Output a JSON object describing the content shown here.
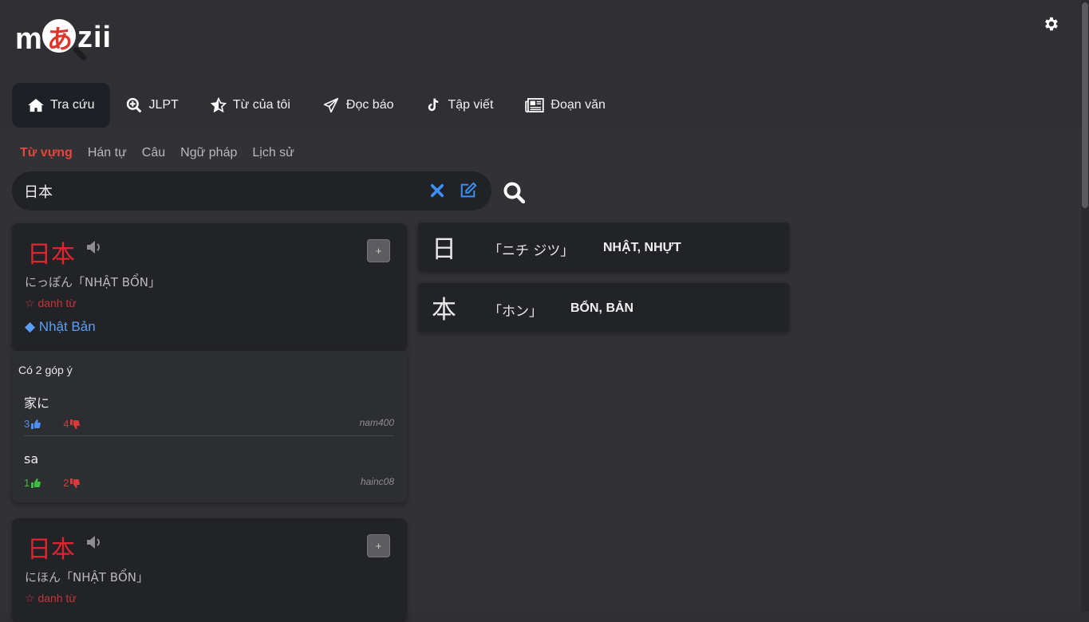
{
  "logo": {
    "left": "m",
    "kana": "あ",
    "right": "zii"
  },
  "nav": [
    {
      "label": "Tra cứu",
      "icon": "home-icon"
    },
    {
      "label": "JLPT",
      "icon": "zoom-in-icon"
    },
    {
      "label": "Từ của tôi",
      "icon": "star-half-icon"
    },
    {
      "label": "Đọc báo",
      "icon": "paper-plane-icon"
    },
    {
      "label": "Tập viết",
      "icon": "tiktok-icon"
    },
    {
      "label": "Đoạn văn",
      "icon": "newspaper-icon"
    }
  ],
  "subtabs": [
    "Từ vựng",
    "Hán tự",
    "Câu",
    "Ngữ pháp",
    "Lịch sử"
  ],
  "search": {
    "value": "日本"
  },
  "entries": [
    {
      "word": "日本",
      "reading": "にっぽん「NHẬT BỔN」",
      "pos": "☆ danh từ",
      "meaning": "◆ Nhật Bản",
      "add": "+"
    },
    {
      "word": "日本",
      "reading": "にほん「NHẬT BỔN」",
      "pos": "☆ danh từ",
      "add": "+"
    }
  ],
  "comments": {
    "title": "Có 2 góp ý",
    "items": [
      {
        "text": "家に",
        "up": "3",
        "down": "4",
        "user": "nam400"
      },
      {
        "text": "sa",
        "up": "1",
        "down": "2",
        "user": "hainc08"
      }
    ]
  },
  "kanji": [
    {
      "char": "日",
      "on": "「ニチ ジツ」",
      "hanviet": "NHẬT, NHỰT"
    },
    {
      "char": "本",
      "on": "「ホン」",
      "hanviet": "BỔN, BẢN"
    }
  ],
  "colors": {
    "accent": "#e8463a",
    "word": "#e0252f",
    "meaning": "#5a9ff5",
    "background": "#2f2f34",
    "card": "#222327"
  }
}
